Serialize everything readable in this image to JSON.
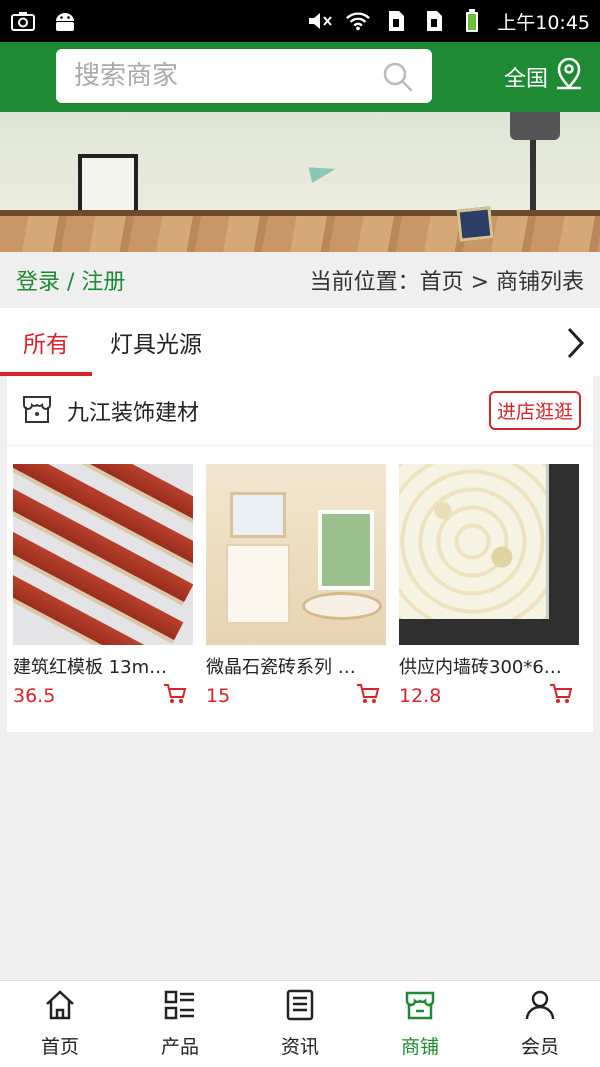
{
  "status_bar": {
    "time": "上午10:45"
  },
  "header": {
    "search_placeholder": "搜索商家",
    "region_label": "全国"
  },
  "breadcrumb": {
    "login_label": "登录 / 注册",
    "location_text": "当前位置：首页 > 商铺列表"
  },
  "tabs": [
    {
      "label": "所有",
      "active": true
    },
    {
      "label": "灯具光源",
      "active": false
    }
  ],
  "shop": {
    "name": "九江装饰建材",
    "visit_button": "进店逛逛",
    "products": [
      {
        "title": "建筑红模板 13m…",
        "price": "36.5",
        "image": "red-formwork-boards"
      },
      {
        "title": "微晶石瓷砖系列 …",
        "price": "15",
        "image": "bathroom-tiles"
      },
      {
        "title": "供应内墙砖300*6…",
        "price": "12.8",
        "image": "damask-wall-tile"
      }
    ]
  },
  "bottom_nav": [
    {
      "label": "首页",
      "icon": "home-icon",
      "active": false
    },
    {
      "label": "产品",
      "icon": "product-list-icon",
      "active": false
    },
    {
      "label": "资讯",
      "icon": "news-icon",
      "active": false
    },
    {
      "label": "商铺",
      "icon": "shop-icon",
      "active": true
    },
    {
      "label": "会员",
      "icon": "member-icon",
      "active": false
    }
  ],
  "colors": {
    "brand_green": "#1e8a34",
    "accent_red": "#d8232a",
    "background": "#efeff0"
  }
}
